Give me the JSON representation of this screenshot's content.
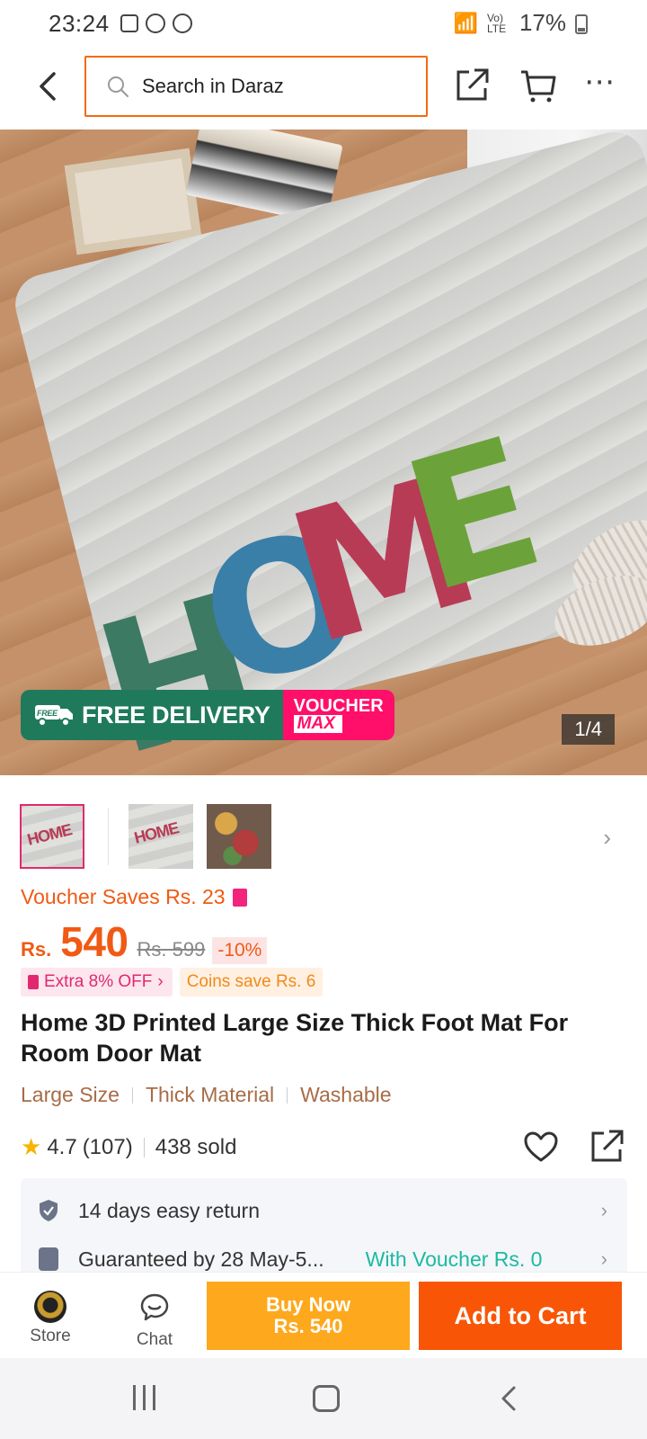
{
  "status_bar": {
    "time": "23:24",
    "network": "Vo) LTE",
    "battery": "17%"
  },
  "search": {
    "placeholder": "Search in Daraz"
  },
  "hero": {
    "badge_free_delivery": "FREE DELIVERY",
    "badge_free_tag": "FREE",
    "badge_voucher_line1": "VOUCHER",
    "badge_voucher_line2": "MAX",
    "counter": "1/4"
  },
  "pricing": {
    "voucher_saves": "Voucher Saves Rs. 23",
    "currency": "Rs.",
    "price": "540",
    "original_price": "Rs. 599",
    "discount": "-10%",
    "extra_off": "Extra 8% OFF",
    "coins_save": "Coins save Rs. 6"
  },
  "product": {
    "title": "Home 3D Printed Large Size Thick Foot Mat For Room Door Mat",
    "features": [
      "Large Size",
      "Thick Material",
      "Washable"
    ],
    "rating": "4.7",
    "reviews": "(107)",
    "sold": "438 sold"
  },
  "service": {
    "return_policy": "14 days easy return",
    "delivery_partial": "Guaranteed by 28 May-5...",
    "voucher_partial": "With Voucher Rs. 0"
  },
  "actions": {
    "store": "Store",
    "chat": "Chat",
    "buy_now_line1": "Buy Now",
    "buy_now_line2": "Rs. 540",
    "add_to_cart": "Add to Cart"
  },
  "colors": {
    "brand_orange": "#f85606",
    "buy_now": "#fda81d",
    "price": "#f05a14",
    "free_delivery": "#1f7a5c",
    "voucher_pink": "#ff0f6a"
  },
  "icons": {
    "back": "back-arrow-icon",
    "search": "search-icon",
    "share": "share-icon",
    "cart": "cart-icon",
    "more": "more-icon",
    "heart": "heart-icon",
    "star": "star-icon",
    "shield": "shield-icon",
    "chat": "chat-icon"
  }
}
